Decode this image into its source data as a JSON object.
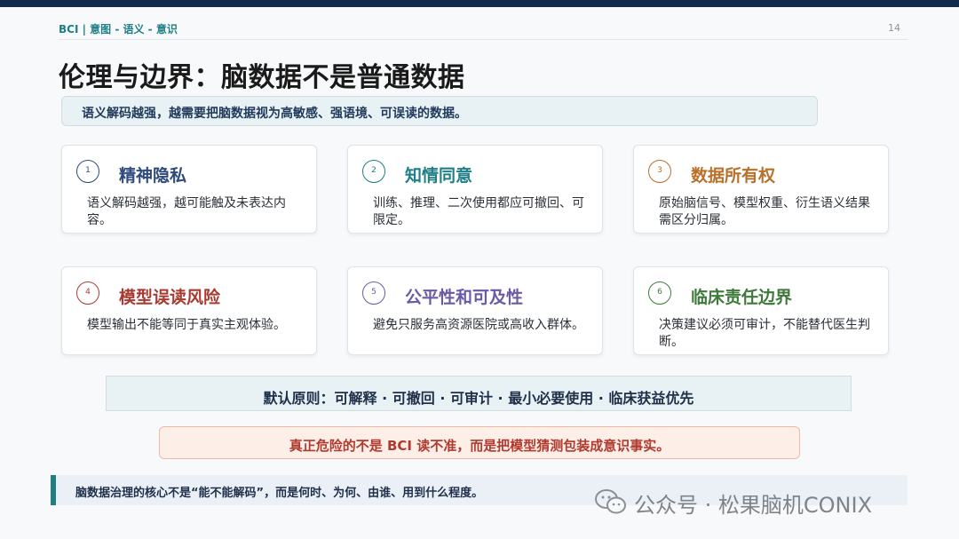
{
  "header": {
    "breadcrumb": "BCI | 意图 - 语义 - 意识",
    "page_number": "14"
  },
  "title": "伦理与边界：脑数据不是普通数据",
  "subtitle": "语义解码越强，越需要把脑数据视为高敏感、强语境、可误读的数据。",
  "cards": [
    {
      "number": "1",
      "title": "精神隐私",
      "description": "语义解码越强，越可能触及未表达内容。",
      "color": "#2f4b7c"
    },
    {
      "number": "2",
      "title": "知情同意",
      "description": "训练、推理、二次使用都应可撤回、可限定。",
      "color": "#1f7f86"
    },
    {
      "number": "3",
      "title": "数据所有权",
      "description": "原始脑信号、模型权重、衍生语义结果需区分归属。",
      "color": "#b8702a"
    },
    {
      "number": "4",
      "title": "模型误读风险",
      "description": "模型输出不能等同于真实主观体验。",
      "color": "#a83a32"
    },
    {
      "number": "5",
      "title": "公平性和可及性",
      "description": "避免只服务高资源医院或高收入群体。",
      "color": "#6a5aa6"
    },
    {
      "number": "6",
      "title": "临床责任边界",
      "description": "决策建议必须可审计，不能替代医生判断。",
      "color": "#3f7a3a"
    }
  ],
  "principles": "默认原则：可解释 · 可撤回 · 可审计 · 最小必要使用 · 临床获益优先",
  "warning": "真正危险的不是 BCI 读不准，而是把模型猜测包装成意识事实。",
  "footer": "脑数据治理的核心不是“能不能解码”，而是何时、为何、由谁、用到什么程度。",
  "watermark": "公众号 · 松果脑机CONIX",
  "icons": {
    "watermark_icon": "wechat-icon"
  }
}
